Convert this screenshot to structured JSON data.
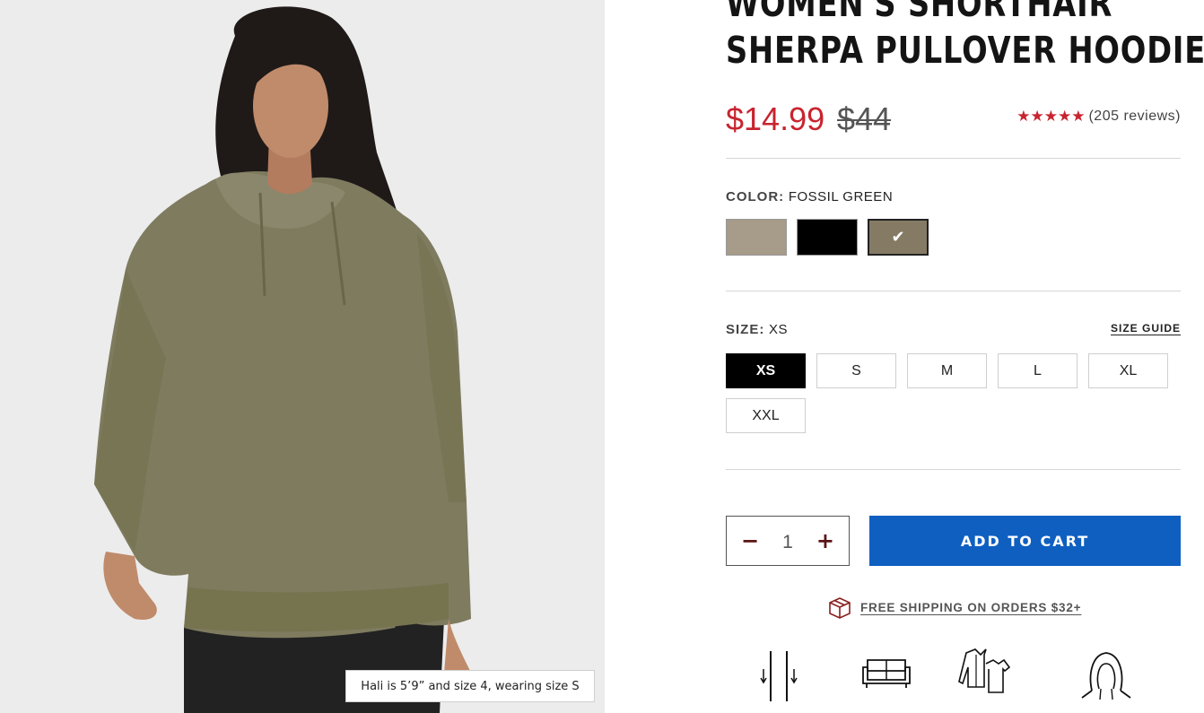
{
  "product": {
    "title_line1": "WOMEN'S SHORTHAIR",
    "title_line2": "SHERPA PULLOVER HOODIE",
    "sale_price": "$14.99",
    "original_price": "$44",
    "stars": "★★★★★",
    "rating_value": 5,
    "reviews": "(205 reviews)"
  },
  "image": {
    "caption": "Hali is 5’9” and size 4, wearing size S"
  },
  "color": {
    "label": "COLOR:",
    "selected": "FOSSIL GREEN",
    "swatches": [
      {
        "name": "taupe",
        "hex": "#a79b89"
      },
      {
        "name": "black",
        "hex": "#000000"
      },
      {
        "name": "fossil-green",
        "hex": "#857b65",
        "selected": true
      }
    ],
    "check": "✔"
  },
  "size": {
    "label": "SIZE:",
    "selected": "XS",
    "guide": "SIZE GUIDE",
    "options": [
      "XS",
      "S",
      "M",
      "L",
      "XL",
      "XXL"
    ]
  },
  "quantity": {
    "minus": "−",
    "value": "1",
    "plus": "+"
  },
  "cart": {
    "label": "ADD TO CART"
  },
  "shipping": {
    "text": "FREE SHIPPING ON ORDERS $32+",
    "icon": "box-icon"
  },
  "features": {
    "icons": [
      "length-icon",
      "sofa-icon",
      "jacket-icon",
      "hood-icon"
    ]
  },
  "colors": {
    "sale": "#c8242f",
    "button": "#0f5fc1",
    "panel_bg": "#ececec",
    "hoodie": "#7e7b5f"
  }
}
